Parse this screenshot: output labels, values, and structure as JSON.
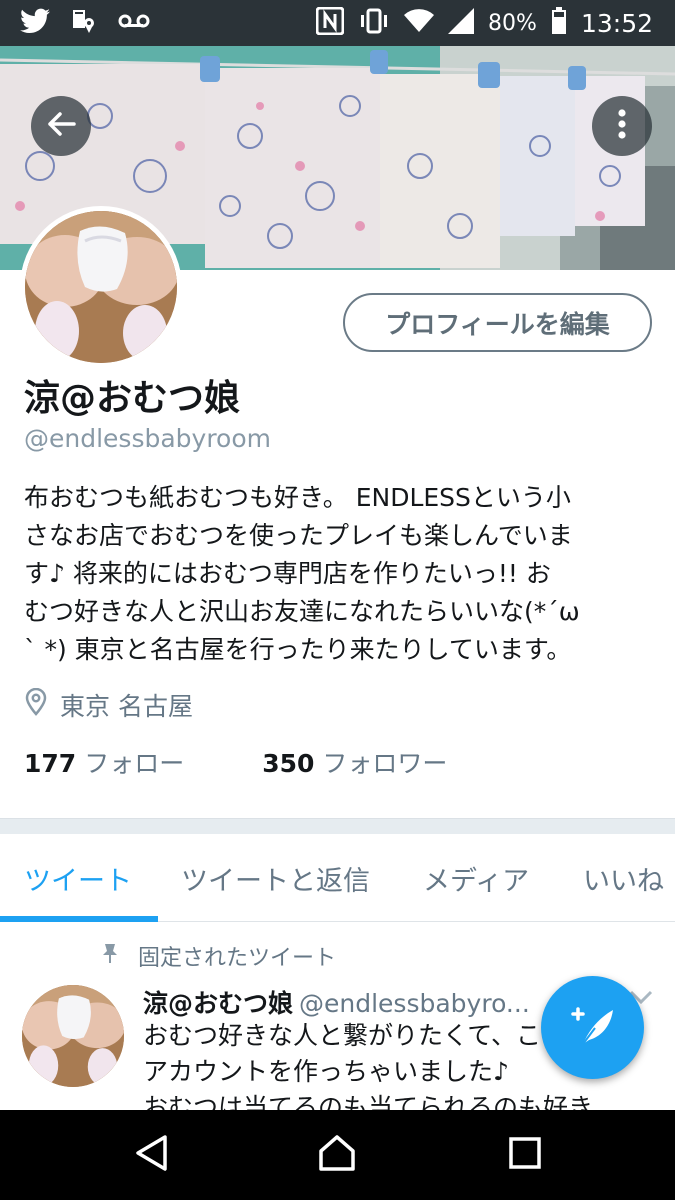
{
  "status_bar": {
    "battery_text": "80%",
    "time": "13:52",
    "icons": [
      "twitter-icon",
      "location-notification-icon",
      "voicemail-icon",
      "nfc-icon",
      "vibrate-icon",
      "wifi-icon",
      "signal-icon",
      "battery-icon"
    ]
  },
  "header": {
    "back_icon": "arrow-left-icon",
    "more_icon": "more-vertical-icon"
  },
  "profile": {
    "edit_button_label": "プロフィールを編集",
    "name": "涼@おむつ娘",
    "handle": "@endlessbabyroom",
    "bio_lines": [
      "布おむつも紙おむつも好き。 ENDLESSという小",
      "さなお店でおむつを使ったプレイも楽しんでいま",
      "す♪ 将来的にはおむつ専門店を作りたいっ!! お",
      "むつ好きな人と沢山お友達になれたらいいな(*´ω",
      "` *) 東京と名古屋を行ったり来たりしています。"
    ],
    "location": "東京 名古屋",
    "following_count": "177",
    "following_label": "フォロー",
    "followers_count": "350",
    "followers_label": "フォロワー"
  },
  "tabs": [
    {
      "label": "ツイート",
      "active": true
    },
    {
      "label": "ツイートと返信",
      "active": false
    },
    {
      "label": "メディア",
      "active": false
    },
    {
      "label": "いいね",
      "active": false
    }
  ],
  "tweet": {
    "pinned_label": "固定されたツイート",
    "name": "涼@おむつ娘",
    "handle": "@endlessbabyro...",
    "lines": [
      "おむつ好きな人と繋がりたくて、こ",
      "アカウントを作っちゃいました♪",
      "おむつは当てるのも当てられるのも好き"
    ]
  },
  "fab": {
    "icon": "compose-tweet-icon"
  },
  "nav": {
    "icons": [
      "back-triangle-icon",
      "home-icon",
      "recents-icon"
    ]
  },
  "colors": {
    "accent": "#1da1f2",
    "status_bar": "#2b3338",
    "secondary_text": "#657786",
    "nav_bar": "#000000"
  }
}
